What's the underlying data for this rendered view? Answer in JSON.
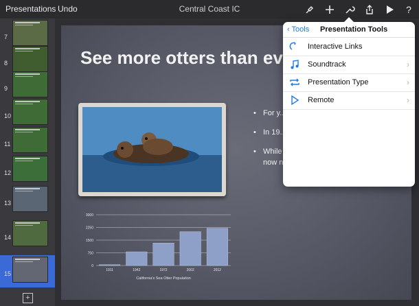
{
  "toolbar": {
    "presentations_label": "Presentations",
    "undo_label": "Undo",
    "doc_title": "Central Coast IC"
  },
  "sidebar": {
    "slides": [
      {
        "num": "7",
        "color": "#5a6b45"
      },
      {
        "num": "8",
        "color": "#3f5d2f",
        "title": "Take to the skies"
      },
      {
        "num": "9",
        "color": "#3e6b36",
        "title": "Keep an eye for the sky"
      },
      {
        "num": "10",
        "color": "#3e6b36",
        "title": "Keep an eye for the sky"
      },
      {
        "num": "11",
        "color": "#3e6b36",
        "title": "Keep an eye for the sky"
      },
      {
        "num": "12",
        "color": "#3c6e39",
        "title": "Explore the sea"
      },
      {
        "num": "13",
        "color": "#5b6675",
        "title": "Spend a day on the water"
      },
      {
        "num": "14",
        "color": "#4f6a3f",
        "title": "Look around the tide pools"
      },
      {
        "num": "15",
        "color": "#636673",
        "title": "See more otters than ever"
      }
    ],
    "add_label": "+"
  },
  "slide": {
    "title": "See more otters than ever.",
    "bullets": [
      "For y... otters ... they ...",
      "In 19... Prote... to hu...",
      "While sea otters remain endangered, they now number almost 3000 in California."
    ]
  },
  "chart_data": {
    "type": "bar",
    "title": "California's Sea Otter Population",
    "categories": [
      "1911",
      "1942",
      "1972",
      "2002",
      "2012"
    ],
    "values": [
      50,
      810,
      1330,
      2000,
      2200
    ],
    "ylim": [
      0,
      3000
    ],
    "yticks": [
      "3000",
      "2250",
      "1500",
      "750",
      "0"
    ],
    "bar_color": "#8ea0c8"
  },
  "popover": {
    "back_label": "Tools",
    "title": "Presentation Tools",
    "items": [
      {
        "label": "Interactive Links",
        "icon": "link-icon",
        "chevron": false
      },
      {
        "label": "Soundtrack",
        "icon": "music-note-icon",
        "chevron": true
      },
      {
        "label": "Presentation Type",
        "icon": "repeat-icon",
        "chevron": true
      },
      {
        "label": "Remote",
        "icon": "play-icon",
        "chevron": true
      }
    ]
  },
  "colors": {
    "accent": "#1f7ae0",
    "selection": "#3b6ad6"
  }
}
